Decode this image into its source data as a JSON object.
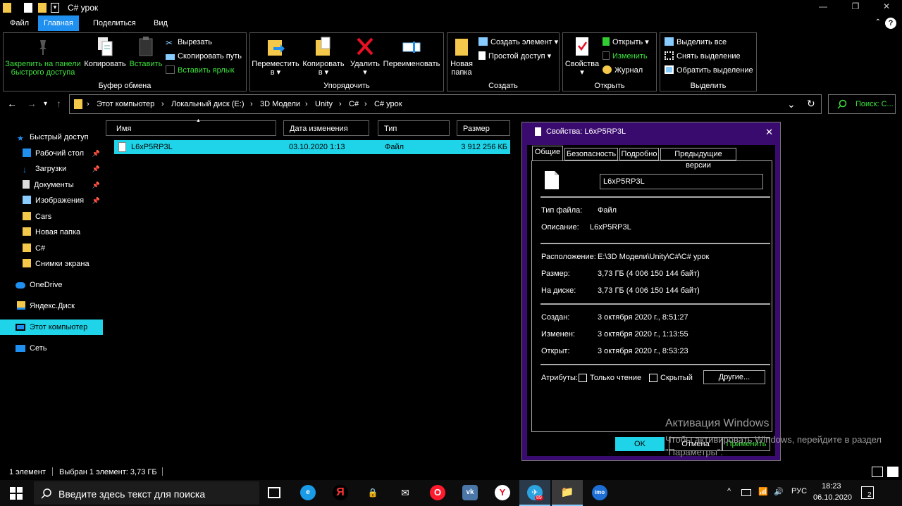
{
  "window": {
    "title": "C# урок",
    "controls": {
      "minimize": "—",
      "restore": "❐",
      "close": "✕"
    }
  },
  "quick_access": {
    "dropdown": "▾"
  },
  "ribbon_tabs": [
    "Файл",
    "Главная",
    "Поделиться",
    "Вид"
  ],
  "ribbon_collapse": "⌃",
  "ribbon_help": "?",
  "ribbon": {
    "clipboard": {
      "label": "Буфер обмена",
      "pin_line1": "Закрепить на панели",
      "pin_line2": "быстрого доступа",
      "copy": "Копировать",
      "paste": "Вставить",
      "cut": "Вырезать",
      "copy_path": "Скопировать путь",
      "paste_shortcut": "Вставить ярлык"
    },
    "organize": {
      "label": "Упорядочить",
      "move_line1": "Переместить",
      "move_line2": "в ▾",
      "copy_line1": "Копировать",
      "copy_line2": "в ▾",
      "delete_line1": "Удалить",
      "delete_line2": "▾",
      "rename": "Переименовать"
    },
    "new": {
      "label": "Создать",
      "new_folder_line1": "Новая",
      "new_folder_line2": "папка",
      "new_item": "Создать элемент ▾",
      "easy_access": "Простой доступ ▾"
    },
    "open": {
      "label": "Открыть",
      "properties_line1": "Свойства",
      "properties_line2": "▾",
      "open": "Открыть ▾",
      "edit": "Изменить",
      "history": "Журнал"
    },
    "select": {
      "label": "Выделить",
      "select_all": "Выделить все",
      "select_none": "Снять выделение",
      "invert": "Обратить выделение"
    }
  },
  "nav_buttons": {
    "back": "←",
    "forward": "→",
    "recent": "▾",
    "up": "↑",
    "dropdown": "⌄",
    "refresh": "↻"
  },
  "breadcrumb": [
    "Этот компьютер",
    "Локальный диск (E:)",
    "3D Модели",
    "Unity",
    "C#",
    "C# урок"
  ],
  "breadcrumb_sep": "›",
  "search": {
    "placeholder": "Поиск: С..."
  },
  "nav_pane": [
    {
      "label": "Быстрый доступ",
      "pinned": false
    },
    {
      "label": "Рабочий стол",
      "pinned": true
    },
    {
      "label": "Загрузки",
      "pinned": true
    },
    {
      "label": "Документы",
      "pinned": true
    },
    {
      "label": "Изображения",
      "pinned": true
    },
    {
      "label": "Cars",
      "pinned": false
    },
    {
      "label": "Новая папка",
      "pinned": false
    },
    {
      "label": "C#",
      "pinned": false
    },
    {
      "label": "Снимки экрана",
      "pinned": false
    },
    {
      "label": "OneDrive",
      "pinned": false
    },
    {
      "label": "Яндекс.Диск",
      "pinned": false
    },
    {
      "label": "Этот компьютер",
      "pinned": false
    },
    {
      "label": "Сеть",
      "pinned": false
    }
  ],
  "pin_glyph": "📌",
  "columns": [
    "Имя",
    "Дата изменения",
    "Тип",
    "Размер"
  ],
  "sort_indicator": "▲",
  "files": [
    {
      "name": "L6xP5RP3L",
      "modified": "03.10.2020 1:13",
      "type": "Файл",
      "size": "3 912 256 КБ"
    }
  ],
  "properties": {
    "title": "Свойства: L6xP5RP3L",
    "close": "✕",
    "tabs": [
      "Общие",
      "Безопасность",
      "Подробно",
      "Предыдущие версии"
    ],
    "name": "L6xP5RP3L",
    "file_type_label": "Тип файла:",
    "file_type": "Файл",
    "description_label": "Описание:",
    "description": "L6xP5RP3L",
    "location_label": "Расположение:",
    "location": "E:\\3D Модели\\Unity\\C#\\C# урок",
    "size_label": "Размер:",
    "size": "3,73 ГБ (4 006 150 144 байт)",
    "disk_label": "На диске:",
    "disk_size": "3,73 ГБ (4 006 150 144 байт)",
    "created_label": "Создан:",
    "created": "3 октября 2020 г., 8:51:27",
    "modified_label": "Изменен:",
    "modified": "3 октября 2020 г., 1:13:55",
    "opened_label": "Открыт:",
    "opened": "3 октября 2020 г., 8:53:23",
    "attributes_label": "Атрибуты:",
    "readonly": "Только чтение",
    "hidden": "Скрытый",
    "other": "Другие...",
    "ok": "OK",
    "cancel": "Отмена",
    "apply": "Применить"
  },
  "watermark": {
    "line1": "Активация Windows",
    "line2": "Чтобы активировать Windows, перейдите в раздел \"Параметры\"."
  },
  "status": {
    "count": "1 элемент",
    "selection": "Выбран 1 элемент: 3,73 ГБ"
  },
  "taskbar": {
    "search_placeholder": "Введите здесь текст для поиска",
    "apps": [
      {
        "glyph": "e",
        "color": "#1a9be8"
      },
      {
        "glyph": "Я",
        "color": "#ff3333"
      },
      {
        "glyph": "🔒",
        "color": "#222222"
      },
      {
        "glyph": "✉",
        "color": "#222222"
      },
      {
        "glyph": "O",
        "color": "#ff1b2d"
      },
      {
        "glyph": "vk",
        "color": "#4a76a8"
      },
      {
        "glyph": "Y",
        "color": "#ffffff"
      },
      {
        "glyph": "✈",
        "color": "#2aa3e0"
      },
      {
        "glyph": "📁",
        "color": "#f4c84a"
      },
      {
        "glyph": "imo",
        "color": "#1d6fd6"
      }
    ],
    "telegram_badge": "89",
    "language": "РУС",
    "time": "18:23",
    "date": "06.10.2020",
    "notifications": "2"
  },
  "colors": {
    "accent": "#1f8ff0",
    "selection": "#1fd4e8",
    "dialog_frame": "#3a0b6e",
    "green_text": "#3ee33e",
    "folder": "#f4c84a"
  }
}
